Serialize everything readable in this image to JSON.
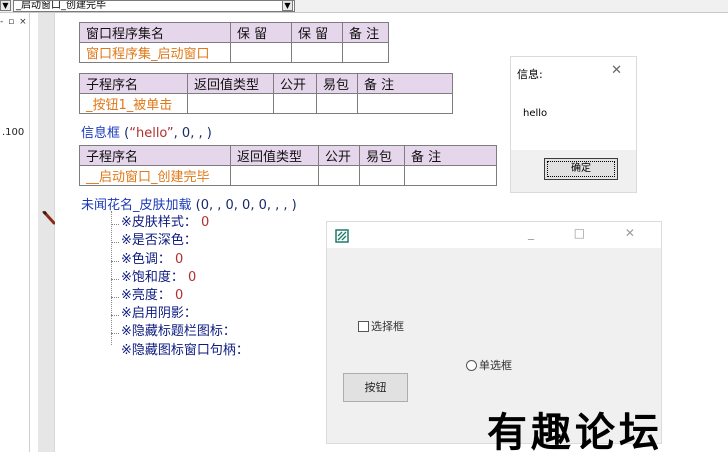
{
  "topbar": {
    "dropdown_arrow": "▼",
    "combo_value": "_启动窗口_创建完毕",
    "combo_arrow": "▼"
  },
  "left_panel": {
    "controls": "- ▫ ×",
    "number": ".100"
  },
  "assembly_table": {
    "headers": [
      "窗口程序集名",
      "保 留",
      "保 留",
      "备 注"
    ],
    "values": [
      "窗口程序集_启动窗口",
      "",
      "",
      ""
    ]
  },
  "sub1_table": {
    "headers": [
      "子程序名",
      "返回值类型",
      "公开",
      "易包",
      "备 注"
    ],
    "values": [
      "_按钮1_被单击",
      "",
      "",
      "",
      ""
    ]
  },
  "line_msgbox": {
    "call": "信息框",
    "open": " (",
    "arg": "“hello”",
    "rest": ", 0, , )"
  },
  "sub2_table": {
    "headers": [
      "子程序名",
      "返回值类型",
      "公开",
      "易包",
      "备 注"
    ],
    "values": [
      "__启动窗口_创建完毕",
      "",
      "",
      "",
      ""
    ]
  },
  "line_skin": {
    "call": "未闻花名_皮肤加载",
    "args": " (0, , 0, 0, 0, , , )"
  },
  "skin_params": [
    {
      "label": "※皮肤样式：",
      "value": "0"
    },
    {
      "label": "※是否深色：",
      "value": ""
    },
    {
      "label": "※色调：",
      "value": "0"
    },
    {
      "label": "※饱和度：",
      "value": "0"
    },
    {
      "label": "※亮度：",
      "value": "0"
    },
    {
      "label": "※启用阴影：",
      "value": ""
    },
    {
      "label": "※隐藏标题栏图标：",
      "value": ""
    },
    {
      "label": "※隐藏图标窗口句柄：",
      "value": ""
    }
  ],
  "message_box": {
    "title": "信息:",
    "close": "✕",
    "message": "hello",
    "ok_label": "确定"
  },
  "app_window": {
    "controls": "_ □ ✕",
    "checkbox_label": "选择框",
    "radio_label": "单选框",
    "button_label": "按钮"
  },
  "watermark": "有趣论坛",
  "colors": {
    "table_header_bg": "#e6d6ec",
    "table_value_text": "#e07818",
    "code_blue": "#1a3ab8",
    "param_navy": "#0b1a80",
    "value_red": "#b03030"
  }
}
